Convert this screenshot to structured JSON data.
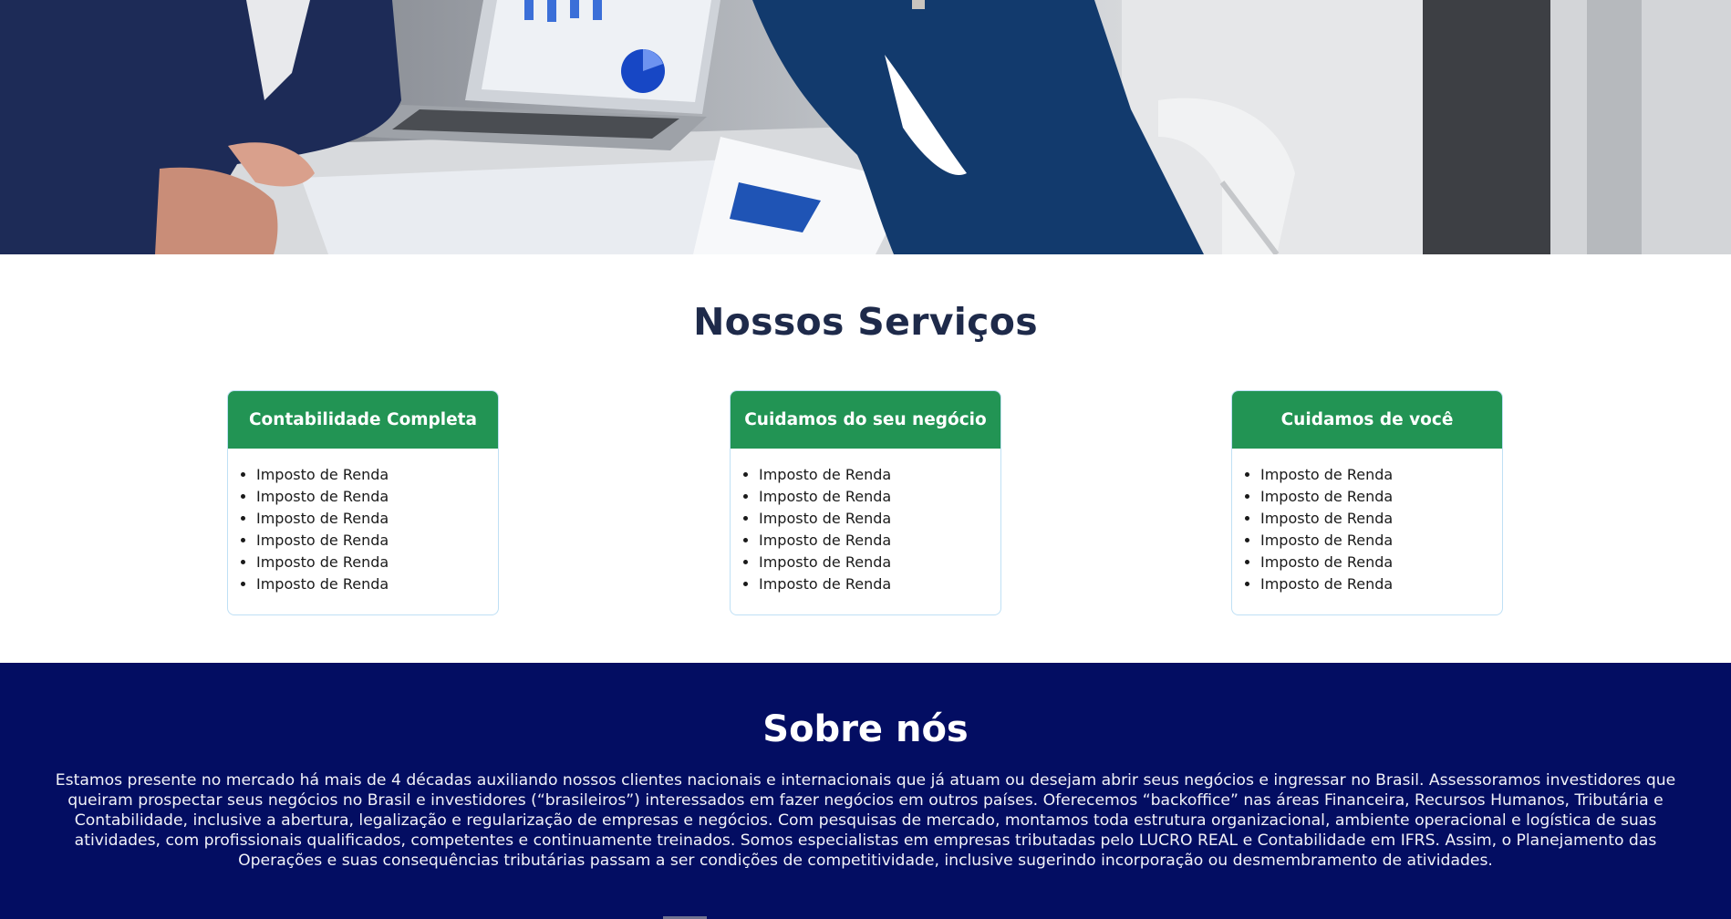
{
  "hero": {
    "image": "office-meeting-photo"
  },
  "services": {
    "title": "Nossos Serviços",
    "cards": [
      {
        "title": "Contabilidade Completa",
        "items": [
          "Imposto de Renda",
          "Imposto de Renda",
          "Imposto de Renda",
          "Imposto de Renda",
          "Imposto de Renda",
          "Imposto de Renda"
        ]
      },
      {
        "title": "Cuidamos do seu negócio",
        "items": [
          "Imposto de Renda",
          "Imposto de Renda",
          "Imposto de Renda",
          "Imposto de Renda",
          "Imposto de Renda",
          "Imposto de Renda"
        ]
      },
      {
        "title": "Cuidamos de você",
        "items": [
          "Imposto de Renda",
          "Imposto de Renda",
          "Imposto de Renda",
          "Imposto de Renda",
          "Imposto de Renda",
          "Imposto de Renda"
        ]
      }
    ]
  },
  "about": {
    "title": "Sobre nós",
    "text": "Estamos presente no mercado há mais de 4 décadas auxiliando nossos clientes nacionais e internacionais que já atuam ou desejam abrir seus negócios e ingressar no Brasil. Assessoramos investidores que queiram prospectar seus negócios no Brasil e investidores (“brasileiros”) interessados em fazer negócios em outros países. Oferecemos “backoffice” nas áreas Financeira, Recursos Humanos, Tributária e Contabilidade, inclusive a abertura, legalização e regularização de empresas e negócios. Com pesquisas de mercado, montamos toda estrutura organizacional, ambiente operacional e logística de suas atividades, com profissionais qualificados, competentes e continuamente treinados. Somos especialistas em empresas tributadas pelo LUCRO REAL e Contabilidade em IFRS. Assim, o Planejamento das Operações e suas consequências tributárias passam a ser condições de competitividade, inclusive sugerindo incorporação ou desmembramento de atividades."
  },
  "colors": {
    "card_header": "#229454",
    "about_background": "#030d62",
    "title_text": "#1e2a4a"
  }
}
